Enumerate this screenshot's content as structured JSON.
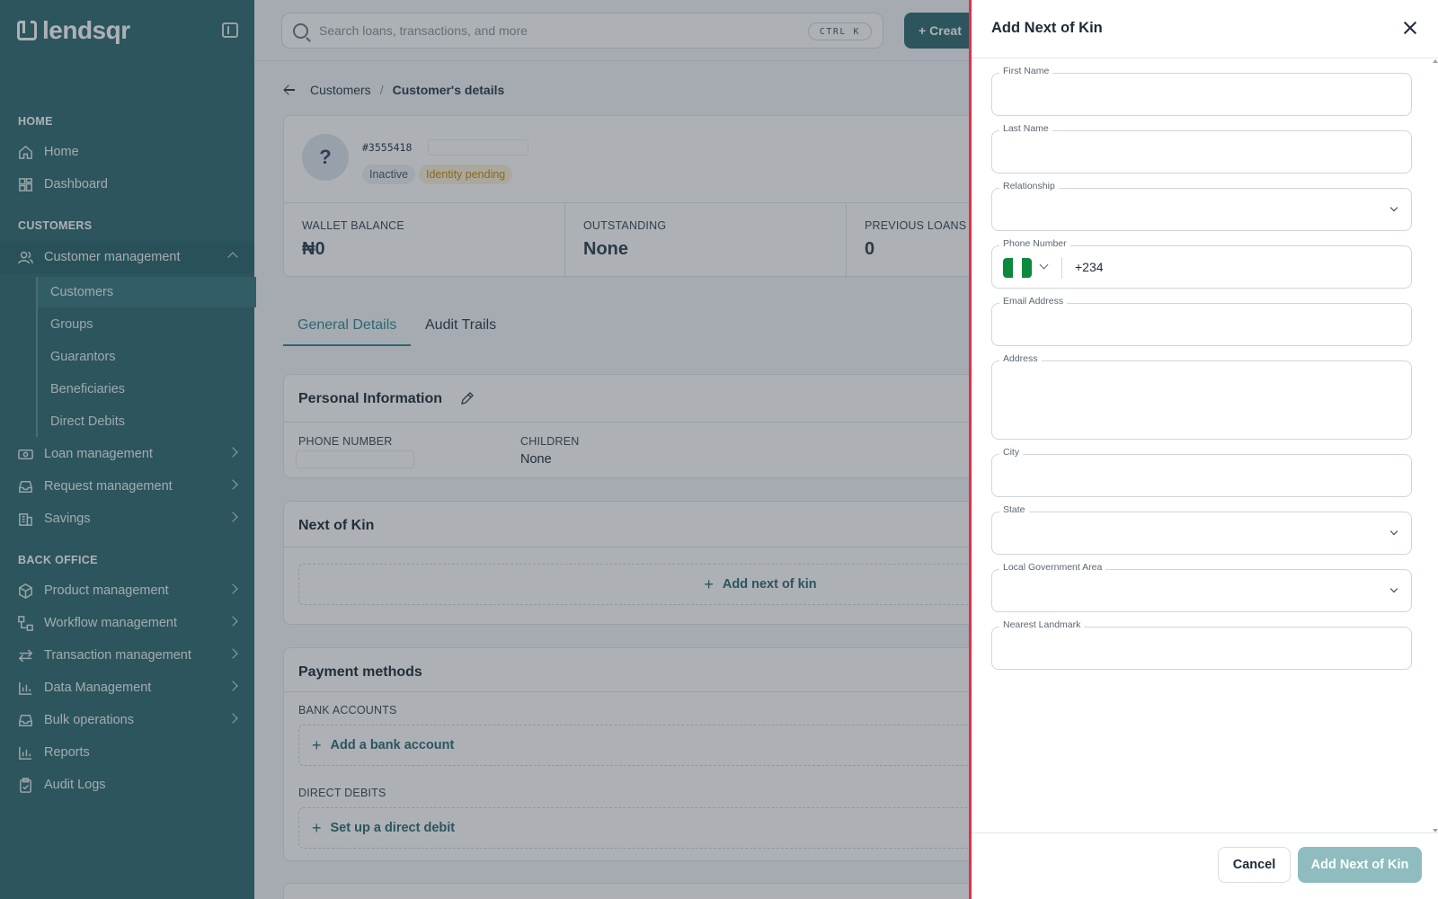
{
  "brand": {
    "name": "lendsqr"
  },
  "search": {
    "placeholder": "Search loans, transactions, and more",
    "shortcut": "CTRL K"
  },
  "header": {
    "create_label": "+ Creat"
  },
  "sidebar": {
    "sections": {
      "home": "HOME",
      "customers": "CUSTOMERS",
      "back_office": "BACK OFFICE"
    },
    "items": {
      "home": "Home",
      "dashboard": "Dashboard",
      "customer_management": "Customer management",
      "loan_management": "Loan management",
      "request_management": "Request management",
      "savings": "Savings",
      "product_management": "Product management",
      "workflow_management": "Workflow management",
      "transaction_management": "Transaction management",
      "data_management": "Data Management",
      "bulk_operations": "Bulk operations",
      "reports": "Reports",
      "audit_logs": "Audit Logs"
    },
    "sub_items": [
      "Customers",
      "Groups",
      "Guarantors",
      "Beneficiaries",
      "Direct Debits"
    ]
  },
  "breadcrumb": {
    "parent": "Customers",
    "separator": "/",
    "current": "Customer's details"
  },
  "profile": {
    "avatar": "?",
    "id": "#3555418",
    "status": "Inactive",
    "identity": "Identity pending",
    "stats": [
      {
        "label": "WALLET BALANCE",
        "value": "₦0"
      },
      {
        "label": "OUTSTANDING",
        "value": "None"
      },
      {
        "label": "PREVIOUS LOANS",
        "value": "0"
      }
    ]
  },
  "tabs": [
    "General Details",
    "Audit Trails"
  ],
  "personal_info": {
    "title": "Personal Information",
    "phone_label": "PHONE NUMBER",
    "children_label": "CHILDREN",
    "children_value": "None"
  },
  "next_of_kin": {
    "title": "Next of Kin",
    "add_label": "Add next of kin"
  },
  "payment_methods": {
    "title": "Payment methods",
    "bank_label": "BANK ACCOUNTS",
    "add_bank": "Add a bank account",
    "debits_label": "DIRECT DEBITS",
    "add_debit": "Set up a direct debit"
  },
  "drawer": {
    "title": "Add Next of Kin",
    "fields": {
      "first_name": "First Name",
      "last_name": "Last Name",
      "relationship": "Relationship",
      "phone": "Phone Number",
      "email": "Email Address",
      "address": "Address",
      "city": "City",
      "state": "State",
      "lga": "Local Government Area",
      "landmark": "Nearest Landmark"
    },
    "phone_code": "+234",
    "cancel": "Cancel",
    "submit": "Add Next of Kin"
  },
  "colors": {
    "sidebar": "#2f6b72",
    "accent": "#2f8a90",
    "drawer_border": "#e0304e",
    "flag_green": "#0b8a3e"
  },
  "icons": [
    "search-icon",
    "collapse-icon",
    "home-icon",
    "dashboard-icon",
    "users-icon",
    "money-icon",
    "inbox-icon",
    "bank-icon",
    "box-icon",
    "workflow-icon",
    "transfer-icon",
    "chart-icon",
    "clipboard-icon",
    "close-icon",
    "pencil-icon",
    "back-arrow-icon",
    "plus-icon"
  ]
}
